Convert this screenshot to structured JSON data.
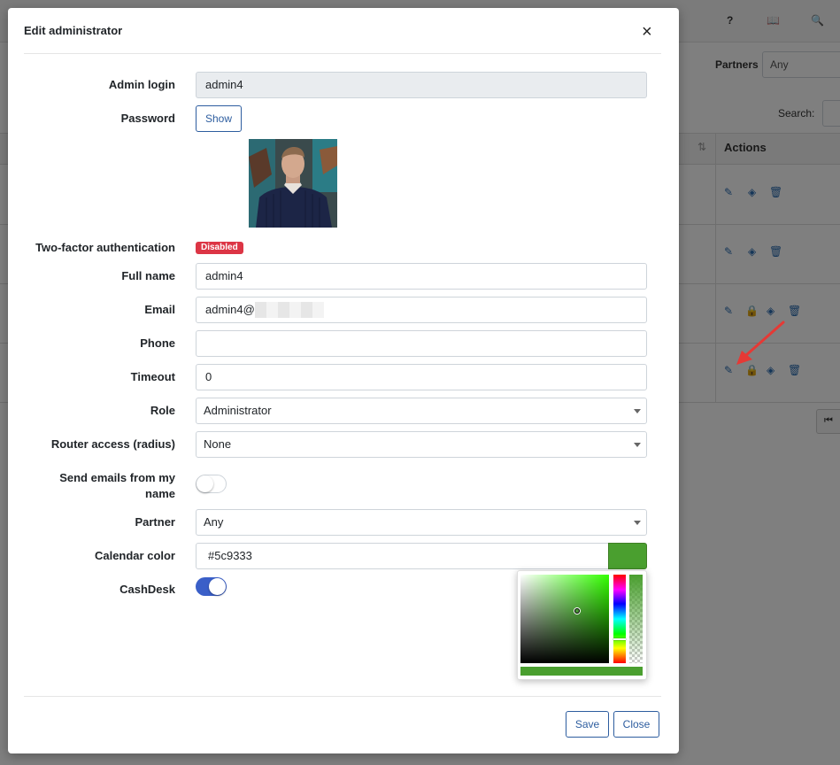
{
  "background": {
    "top_icons": [
      "?",
      "📖",
      "🔍"
    ],
    "partners_label": "Partners",
    "partners_value": "Any",
    "search_label": "Search:",
    "actions_header": "Actions",
    "pager_label": "⏮"
  },
  "modal": {
    "title": "Edit administrator",
    "close_glyph": "×"
  },
  "form": {
    "admin_login": {
      "label": "Admin login",
      "value": "admin4"
    },
    "password": {
      "label": "Password",
      "button": "Show"
    },
    "two_factor": {
      "label": "Two-factor authentication",
      "badge": "Disabled"
    },
    "full_name": {
      "label": "Full name",
      "value": "admin4"
    },
    "email": {
      "label": "Email",
      "value": "admin4@"
    },
    "phone": {
      "label": "Phone",
      "value": ""
    },
    "timeout": {
      "label": "Timeout",
      "value": "0"
    },
    "role": {
      "label": "Role",
      "value": "Administrator"
    },
    "router_access": {
      "label": "Router access (radius)",
      "value": "None"
    },
    "send_emails": {
      "label_line1": "Send emails from my",
      "label_line2": "name",
      "enabled": false
    },
    "partner": {
      "label": "Partner",
      "value": "Any"
    },
    "calendar_color": {
      "label": "Calendar color",
      "value": "#5c9333"
    },
    "cashdesk": {
      "label": "CashDesk",
      "enabled": true
    }
  },
  "colors": {
    "calendar_swatch": "#4a9f2f",
    "picker_hue": "#33ff00",
    "primary": "#2d5d9f",
    "danger": "#dc3545",
    "toggle_on": "#3a5fc8"
  },
  "footer": {
    "save_label": "Save",
    "close_label": "Close"
  }
}
